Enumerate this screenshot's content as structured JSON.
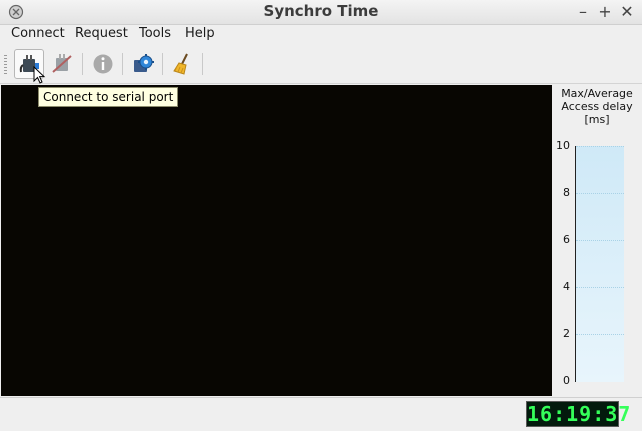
{
  "window": {
    "title": "Synchro Time",
    "minimize": "–",
    "maximize": "+",
    "close": "✕"
  },
  "menu": {
    "items": [
      "Connect",
      "Request",
      "Tools",
      "Help"
    ]
  },
  "toolbar": {
    "buttons": [
      {
        "icon": "serial-connect-icon",
        "state": "pressed"
      },
      {
        "icon": "serial-disconnect-icon",
        "state": "disabled"
      },
      {
        "icon": "info-icon",
        "state": "disabled"
      },
      {
        "icon": "settings-gear-icon",
        "state": "normal"
      },
      {
        "icon": "broom-clear-icon",
        "state": "normal"
      }
    ]
  },
  "tooltip": {
    "text": "Connect to serial port"
  },
  "side_gauge": {
    "title_line1": "Max/Average",
    "title_line2": "Access delay",
    "title_line3": "[ms]",
    "ticks": [
      "10",
      "8",
      "6",
      "4",
      "2",
      "0"
    ],
    "ylim": [
      0,
      10
    ]
  },
  "status": {
    "clock": "16:19:37"
  },
  "colors": {
    "plot_bg": "#080602",
    "clock_fg": "#35ff5a",
    "gauge_fill": "#cfe9f7"
  }
}
